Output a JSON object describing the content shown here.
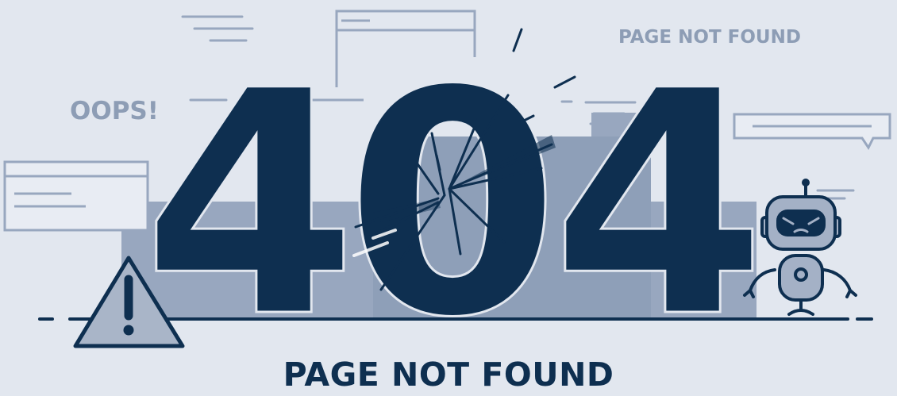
{
  "headline": {
    "digit_left": "4",
    "digit_middle": "0",
    "digit_right": "4"
  },
  "labels": {
    "oops": "OOPS!",
    "top_right": "PAGE NOT FOUND",
    "bottom": "PAGE NOT FOUND"
  },
  "icons": [
    "warning-triangle-icon",
    "robot-icon",
    "browser-window-icon",
    "speech-bubble-icon",
    "message-card-icon",
    "crack-burst-icon"
  ],
  "colors": {
    "background": "#e2e7ef",
    "navy": "#0e2f50",
    "slate": "#8d9db5",
    "outline": "#98a7bf",
    "robot_fill": "#a4b1c6"
  }
}
